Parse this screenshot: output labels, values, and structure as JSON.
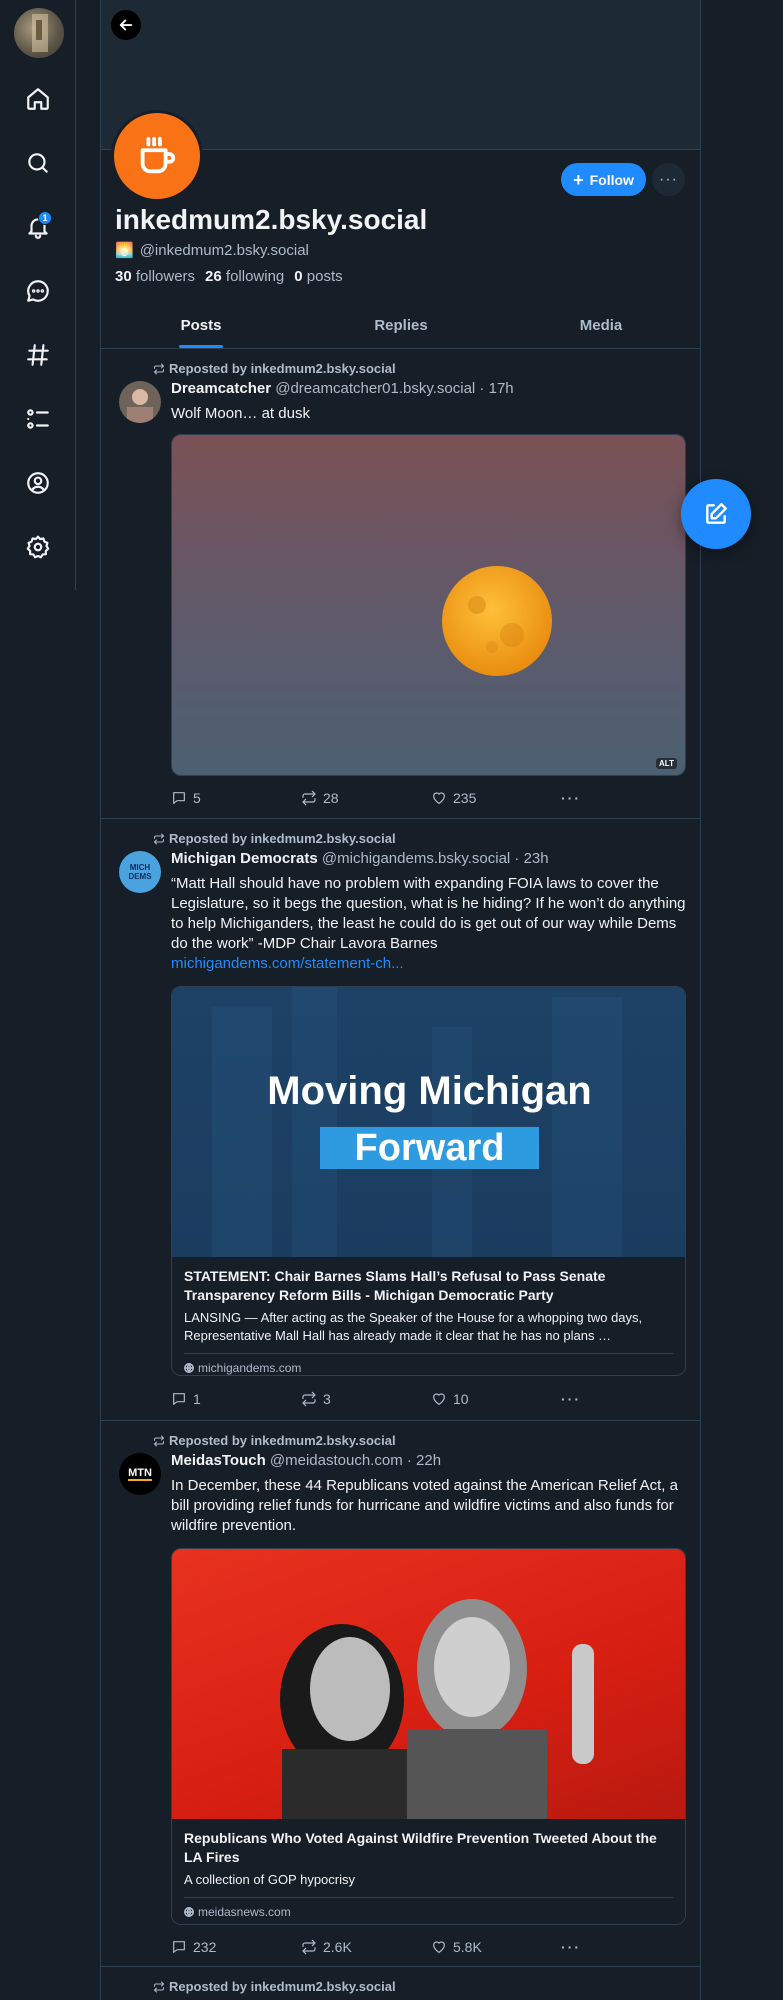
{
  "colors": {
    "bg": "#161e27",
    "accent": "#208bfe",
    "border": "#2e4052",
    "muted": "#aebbc9",
    "avatar_orange": "#f97316"
  },
  "nav": {
    "items": [
      "home-icon",
      "search-icon",
      "bell-icon",
      "chat-icon",
      "hashtag-icon",
      "list-icon",
      "profile-icon",
      "settings-icon"
    ],
    "notification_count": "1"
  },
  "profile": {
    "display_name": "inkedmum2.bsky.social",
    "handle_emoji": "🌅",
    "handle": "@inkedmum2.bsky.social",
    "followers_count": "30",
    "followers_label": "followers",
    "following_count": "26",
    "following_label": "following",
    "posts_count": "0",
    "posts_label": "posts",
    "follow_label": "Follow",
    "more_label": "···"
  },
  "tabs": [
    {
      "label": "Posts",
      "active": true
    },
    {
      "label": "Replies",
      "active": false
    },
    {
      "label": "Media",
      "active": false
    }
  ],
  "posts": [
    {
      "repost_label": "Reposted by inkedmum2.bsky.social",
      "author_name": "Dreamcatcher",
      "author_meta": "@dreamcatcher01.bsky.social · 17h",
      "text": "Wolf Moon… at dusk",
      "alt_badge": "ALT",
      "replies": "5",
      "reposts": "28",
      "likes": "235"
    },
    {
      "repost_label": "Reposted by inkedmum2.bsky.social",
      "author_name": "Michigan Democrats",
      "author_meta": "@michigandems.bsky.social · 23h",
      "avatar_text": "MICH DEMS",
      "text": "“Matt Hall should have no problem with expanding FOIA laws to cover the Legislature, so it begs the question, what is he hiding? If he won’t do anything to help Michiganders, the least he could do is get out of our way while Dems do the work” -MDP Chair Lavora Barnes",
      "link": "michigandems.com/statement-ch...",
      "image_line1": "Moving Michigan",
      "image_line2": "Forward",
      "card_title": "STATEMENT: Chair Barnes Slams Hall’s Refusal to Pass Senate Transparency Reform Bills - Michigan Democratic Party",
      "card_desc": "LANSING — After acting as the Speaker of the House for a whopping two days, Representative Mall Hall has already made it clear that he has no plans …",
      "card_domain": "michigandems.com",
      "replies": "1",
      "reposts": "3",
      "likes": "10"
    },
    {
      "repost_label": "Reposted by inkedmum2.bsky.social",
      "author_name": "MeidasTouch",
      "author_meta": "@meidastouch.com · 22h",
      "avatar_text": "MTN",
      "text": "In December, these 44 Republicans voted against the American Relief Act, a bill providing relief funds for hurricane and wildfire victims and also funds for wildfire prevention.",
      "card_title": "Republicans Who Voted Against Wildfire Prevention Tweeted About the LA Fires",
      "card_desc": "A collection of GOP hypocrisy",
      "card_domain": "meidasnews.com",
      "replies": "232",
      "reposts": "2.6K",
      "likes": "5.8K"
    },
    {
      "repost_label": "Reposted by inkedmum2.bsky.social"
    }
  ]
}
